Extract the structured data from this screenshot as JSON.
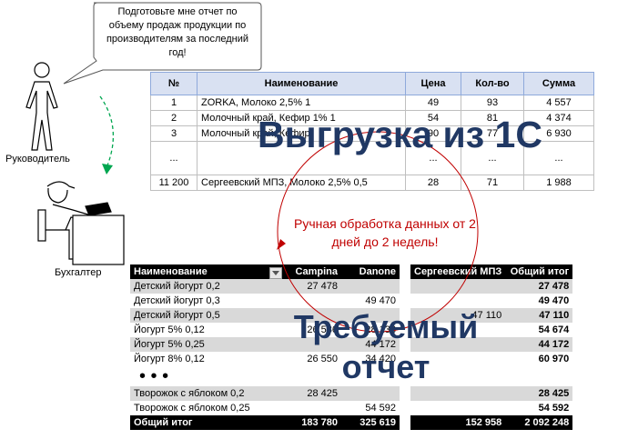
{
  "bubble": {
    "text": "Подготовьте мне отчет по объему продаж продукции по производителям за последний год!"
  },
  "people": {
    "manager_label": "Руководитель",
    "accountant_label": "Бухгалтер"
  },
  "source_table": {
    "headers": [
      "№",
      "Наименование",
      "Цена",
      "Кол-во",
      "Сумма"
    ],
    "rows": [
      [
        "1",
        "ZORKA, Молоко 2,5% 1",
        "49",
        "93",
        "4 557"
      ],
      [
        "2",
        "Молочный край, Кефир 1% 1",
        "54",
        "81",
        "4 374"
      ],
      [
        "3",
        "Молочный край, Кефир",
        "90",
        "77",
        "6 930"
      ],
      [
        "...",
        "",
        "...",
        "...",
        "..."
      ],
      [
        "11 200",
        "Сергеевский МПЗ, Молоко 2,5% 0,5",
        "28",
        "71",
        "1 988"
      ]
    ]
  },
  "caption_export": "Выгрузка из 1С",
  "processing_note": "Ручная обработка данных от 2 дней до 2 недель!",
  "caption_report": "Требуемый отчет",
  "report_table": {
    "headers": [
      "Наименование",
      "Campina",
      "Danone",
      "Сергеевский МПЗ",
      "Общий итог"
    ],
    "rows": [
      [
        "Детский йогурт 0,2",
        "27 478",
        "",
        "",
        "27 478"
      ],
      [
        "Детский йогурт 0,3",
        "",
        "49 470",
        "",
        "49 470"
      ],
      [
        "Детский йогурт 0,5",
        "",
        "",
        "47 110",
        "47 110"
      ],
      [
        "Йогурт 5% 0,12",
        "26 536",
        "28 138",
        "",
        "54 674"
      ],
      [
        "Йогурт 5% 0,25",
        "",
        "44 172",
        "",
        "44 172"
      ],
      [
        "Йогурт 8% 0,12",
        "26 550",
        "34 420",
        "",
        "60 970"
      ]
    ],
    "ellipsis": "• • •",
    "rows_after": [
      [
        "Творожок с яблоком 0,2",
        "28 425",
        "",
        "",
        "28 425"
      ],
      [
        "Творожок с яблоком 0,25",
        "",
        "54 592",
        "",
        "54 592"
      ]
    ],
    "total": [
      "Общий итог",
      "183 780",
      "325 619",
      "152 958",
      "2 092 248"
    ]
  }
}
